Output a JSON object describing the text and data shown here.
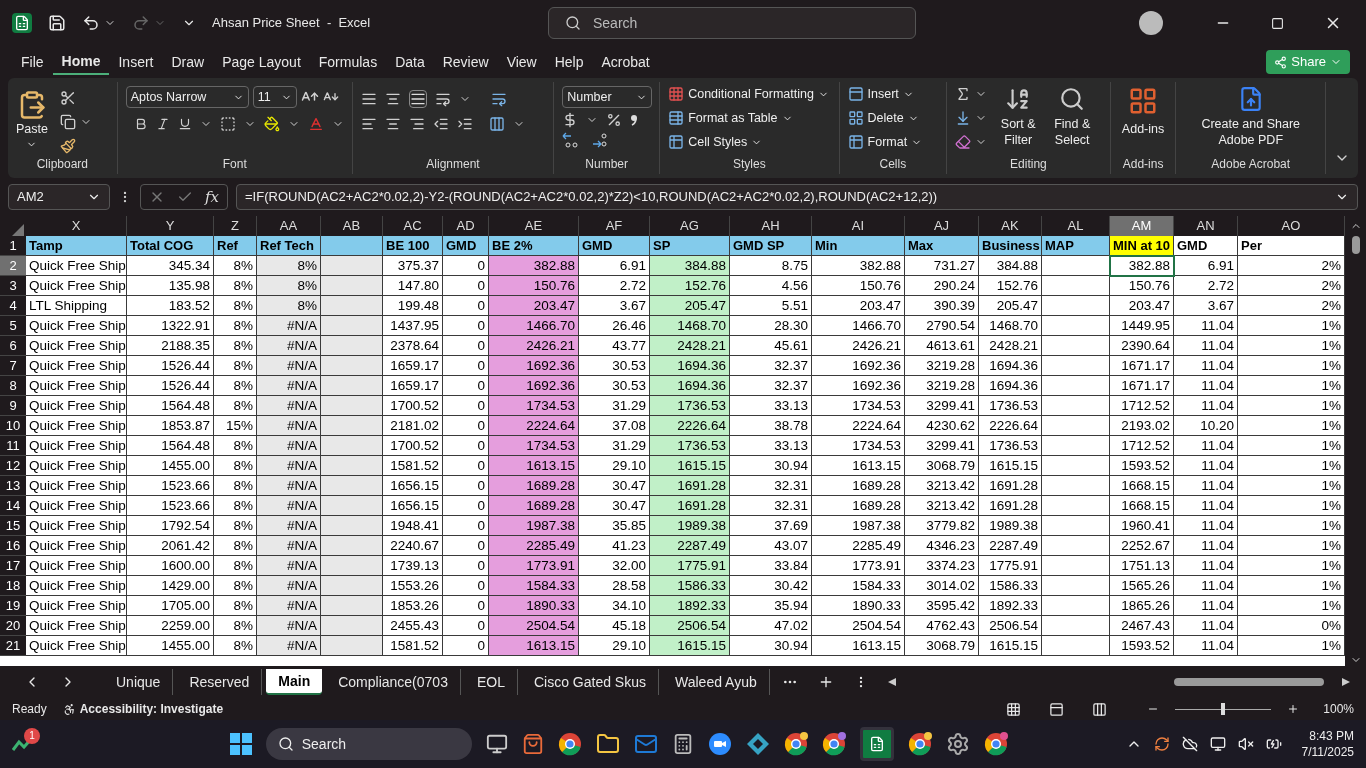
{
  "window": {
    "title": "Ahsan Price Sheet  -  Excel",
    "search_placeholder": "Search"
  },
  "menu_tabs": [
    {
      "label": "File",
      "selected": false
    },
    {
      "label": "Home",
      "selected": true
    },
    {
      "label": "Insert",
      "selected": false
    },
    {
      "label": "Draw",
      "selected": false
    },
    {
      "label": "Page Layout",
      "selected": false
    },
    {
      "label": "Formulas",
      "selected": false
    },
    {
      "label": "Data",
      "selected": false
    },
    {
      "label": "Review",
      "selected": false
    },
    {
      "label": "View",
      "selected": false
    },
    {
      "label": "Help",
      "selected": false
    },
    {
      "label": "Acrobat",
      "selected": false
    }
  ],
  "share_button": "Share",
  "ribbon": {
    "clipboard": {
      "name": "Clipboard",
      "paste": "Paste"
    },
    "font": {
      "name": "Font",
      "font_name": "Aptos Narrow",
      "font_size": "11"
    },
    "alignment": {
      "name": "Alignment"
    },
    "number": {
      "name": "Number",
      "format": "Number"
    },
    "styles": {
      "name": "Styles",
      "buttons": [
        "Conditional Formatting",
        "Format as Table",
        "Cell Styles"
      ]
    },
    "cells": {
      "name": "Cells",
      "buttons": [
        "Insert",
        "Delete",
        "Format"
      ]
    },
    "editing": {
      "name": "Editing",
      "buttons": [
        "Sort & Filter",
        "Find & Select"
      ]
    },
    "addins": {
      "name": "Add-ins",
      "button": "Add-ins"
    },
    "acrobat": {
      "name": "Adobe Acrobat",
      "button": "Create and Share Adobe PDF"
    }
  },
  "formula_bar": {
    "name_box": "AM2",
    "function_label": "fx",
    "formula": "=IF(ROUND(AC2+AC2*0.02,2)-Y2-(ROUND(AC2+AC2*0.02,2)*Z2)<10,ROUND(AC2+AC2*0.02,2),ROUND(AC2+12,2))"
  },
  "columns": [
    {
      "letter": "X",
      "header": "Tamp",
      "kind": "text",
      "color": "#83cbeb",
      "selected": false
    },
    {
      "letter": "Y",
      "header": "Total COG",
      "kind": "number",
      "color": "#83cbeb",
      "selected": false
    },
    {
      "letter": "Z",
      "header": "Ref",
      "kind": "number",
      "color": "#83cbeb",
      "selected": false
    },
    {
      "letter": "AA",
      "header": "Ref Tech",
      "kind": "grey",
      "color": "#83cbeb",
      "selected": false
    },
    {
      "letter": "AB",
      "kind": "grey_blank",
      "color": "#83cbeb",
      "selected": false
    },
    {
      "letter": "AC",
      "header": "BE 100",
      "kind": "number",
      "color": "#83cbeb",
      "selected": false
    },
    {
      "letter": "AD",
      "header": "GMD",
      "kind": "number",
      "color": "#83cbeb",
      "selected": false
    },
    {
      "letter": "AE",
      "header": "BE 2%",
      "kind": "pink",
      "color": "#83cbeb",
      "selected": false
    },
    {
      "letter": "AF",
      "header": "GMD",
      "kind": "number",
      "color": "#83cbeb",
      "selected": false
    },
    {
      "letter": "AG",
      "header": "SP",
      "kind": "green",
      "color": "#83cbeb",
      "selected": false
    },
    {
      "letter": "AH",
      "header": "GMD SP",
      "kind": "number",
      "color": "#83cbeb",
      "selected": false
    },
    {
      "letter": "AI",
      "header": "Min",
      "kind": "number",
      "color": "#83cbeb",
      "selected": false
    },
    {
      "letter": "AJ",
      "header": "Max",
      "kind": "number",
      "color": "#83cbeb",
      "selected": false
    },
    {
      "letter": "AK",
      "header": "Business",
      "kind": "number",
      "color": "#83cbeb",
      "selected": false
    },
    {
      "letter": "AL",
      "header": "MAP",
      "kind": "blank",
      "color": "#83cbeb",
      "selected": false
    },
    {
      "letter": "AM",
      "header": "MIN at 10",
      "kind": "number",
      "color": "#ffff00",
      "selected": true
    },
    {
      "letter": "AN",
      "header": "GMD",
      "kind": "number",
      "color": "#ffffff",
      "selected": false
    },
    {
      "letter": "AO",
      "header": "Per",
      "kind": "number",
      "color": "#ffffff",
      "selected": false
    }
  ],
  "header_row": "1",
  "rows": [
    {
      "n": "2",
      "selected": true,
      "cells": [
        "Quick Free Ship",
        "345.34",
        "8%",
        "8%",
        "375.37",
        "0",
        "382.88",
        "6.91",
        "384.88",
        "8.75",
        "382.88",
        "731.27",
        "384.88",
        "382.88",
        "6.91",
        "2%"
      ]
    },
    {
      "n": "3",
      "selected": false,
      "cells": [
        "Quick Free Ship",
        "135.98",
        "8%",
        "8%",
        "147.80",
        "0",
        "150.76",
        "2.72",
        "152.76",
        "4.56",
        "150.76",
        "290.24",
        "152.76",
        "150.76",
        "2.72",
        "2%"
      ]
    },
    {
      "n": "4",
      "selected": false,
      "cells": [
        "LTL Shipping",
        "183.52",
        "8%",
        "8%",
        "199.48",
        "0",
        "203.47",
        "3.67",
        "205.47",
        "5.51",
        "203.47",
        "390.39",
        "205.47",
        "203.47",
        "3.67",
        "2%"
      ]
    },
    {
      "n": "5",
      "selected": false,
      "cells": [
        "Quick Free Ship",
        "1322.91",
        "8%",
        "#N/A",
        "1437.95",
        "0",
        "1466.70",
        "26.46",
        "1468.70",
        "28.30",
        "1466.70",
        "2790.54",
        "1468.70",
        "1449.95",
        "11.04",
        "1%"
      ]
    },
    {
      "n": "6",
      "selected": false,
      "cells": [
        "Quick Free Ship",
        "2188.35",
        "8%",
        "#N/A",
        "2378.64",
        "0",
        "2426.21",
        "43.77",
        "2428.21",
        "45.61",
        "2426.21",
        "4613.61",
        "2428.21",
        "2390.64",
        "11.04",
        "1%"
      ]
    },
    {
      "n": "7",
      "selected": false,
      "cells": [
        "Quick Free Ship",
        "1526.44",
        "8%",
        "#N/A",
        "1659.17",
        "0",
        "1692.36",
        "30.53",
        "1694.36",
        "32.37",
        "1692.36",
        "3219.28",
        "1694.36",
        "1671.17",
        "11.04",
        "1%"
      ]
    },
    {
      "n": "8",
      "selected": false,
      "cells": [
        "Quick Free Ship",
        "1526.44",
        "8%",
        "#N/A",
        "1659.17",
        "0",
        "1692.36",
        "30.53",
        "1694.36",
        "32.37",
        "1692.36",
        "3219.28",
        "1694.36",
        "1671.17",
        "11.04",
        "1%"
      ]
    },
    {
      "n": "9",
      "selected": false,
      "cells": [
        "Quick Free Ship",
        "1564.48",
        "8%",
        "#N/A",
        "1700.52",
        "0",
        "1734.53",
        "31.29",
        "1736.53",
        "33.13",
        "1734.53",
        "3299.41",
        "1736.53",
        "1712.52",
        "11.04",
        "1%"
      ]
    },
    {
      "n": "10",
      "selected": false,
      "cells": [
        "Quick Free Ship",
        "1853.87",
        "15%",
        "#N/A",
        "2181.02",
        "0",
        "2224.64",
        "37.08",
        "2226.64",
        "38.78",
        "2224.64",
        "4230.62",
        "2226.64",
        "2193.02",
        "10.20",
        "1%"
      ]
    },
    {
      "n": "11",
      "selected": false,
      "cells": [
        "Quick Free Ship",
        "1564.48",
        "8%",
        "#N/A",
        "1700.52",
        "0",
        "1734.53",
        "31.29",
        "1736.53",
        "33.13",
        "1734.53",
        "3299.41",
        "1736.53",
        "1712.52",
        "11.04",
        "1%"
      ]
    },
    {
      "n": "12",
      "selected": false,
      "cells": [
        "Quick Free Ship",
        "1455.00",
        "8%",
        "#N/A",
        "1581.52",
        "0",
        "1613.15",
        "29.10",
        "1615.15",
        "30.94",
        "1613.15",
        "3068.79",
        "1615.15",
        "1593.52",
        "11.04",
        "1%"
      ]
    },
    {
      "n": "13",
      "selected": false,
      "cells": [
        "Quick Free Ship",
        "1523.66",
        "8%",
        "#N/A",
        "1656.15",
        "0",
        "1689.28",
        "30.47",
        "1691.28",
        "32.31",
        "1689.28",
        "3213.42",
        "1691.28",
        "1668.15",
        "11.04",
        "1%"
      ]
    },
    {
      "n": "14",
      "selected": false,
      "cells": [
        "Quick Free Ship",
        "1523.66",
        "8%",
        "#N/A",
        "1656.15",
        "0",
        "1689.28",
        "30.47",
        "1691.28",
        "32.31",
        "1689.28",
        "3213.42",
        "1691.28",
        "1668.15",
        "11.04",
        "1%"
      ]
    },
    {
      "n": "15",
      "selected": false,
      "cells": [
        "Quick Free Ship",
        "1792.54",
        "8%",
        "#N/A",
        "1948.41",
        "0",
        "1987.38",
        "35.85",
        "1989.38",
        "37.69",
        "1987.38",
        "3779.82",
        "1989.38",
        "1960.41",
        "11.04",
        "1%"
      ]
    },
    {
      "n": "16",
      "selected": false,
      "cells": [
        "Quick Free Ship",
        "2061.42",
        "8%",
        "#N/A",
        "2240.67",
        "0",
        "2285.49",
        "41.23",
        "2287.49",
        "43.07",
        "2285.49",
        "4346.23",
        "2287.49",
        "2252.67",
        "11.04",
        "1%"
      ]
    },
    {
      "n": "17",
      "selected": false,
      "cells": [
        "Quick Free Ship",
        "1600.00",
        "8%",
        "#N/A",
        "1739.13",
        "0",
        "1773.91",
        "32.00",
        "1775.91",
        "33.84",
        "1773.91",
        "3374.23",
        "1775.91",
        "1751.13",
        "11.04",
        "1%"
      ]
    },
    {
      "n": "18",
      "selected": false,
      "cells": [
        "Quick Free Ship",
        "1429.00",
        "8%",
        "#N/A",
        "1553.26",
        "0",
        "1584.33",
        "28.58",
        "1586.33",
        "30.42",
        "1584.33",
        "3014.02",
        "1586.33",
        "1565.26",
        "11.04",
        "1%"
      ]
    },
    {
      "n": "19",
      "selected": false,
      "cells": [
        "Quick Free Ship",
        "1705.00",
        "8%",
        "#N/A",
        "1853.26",
        "0",
        "1890.33",
        "34.10",
        "1892.33",
        "35.94",
        "1890.33",
        "3595.42",
        "1892.33",
        "1865.26",
        "11.04",
        "1%"
      ]
    },
    {
      "n": "20",
      "selected": false,
      "cells": [
        "Quick Free Ship",
        "2259.00",
        "8%",
        "#N/A",
        "2455.43",
        "0",
        "2504.54",
        "45.18",
        "2506.54",
        "47.02",
        "2504.54",
        "4762.43",
        "2506.54",
        "2467.43",
        "11.04",
        "0%"
      ]
    },
    {
      "n": "21",
      "selected": false,
      "cells": [
        "Quick Free Ship",
        "1455.00",
        "8%",
        "#N/A",
        "1581.52",
        "0",
        "1613.15",
        "29.10",
        "1615.15",
        "30.94",
        "1613.15",
        "3068.79",
        "1615.15",
        "1593.52",
        "11.04",
        "1%"
      ]
    }
  ],
  "sheet_tabs": [
    {
      "label": "Unique",
      "selected": false
    },
    {
      "label": "Reserved",
      "selected": false
    },
    {
      "label": "Main",
      "selected": true
    },
    {
      "label": "Compliance(0703",
      "selected": false
    },
    {
      "label": "EOL",
      "selected": false
    },
    {
      "label": "Cisco Gated Skus",
      "selected": false
    },
    {
      "label": "Waleed Ayub",
      "selected": false
    }
  ],
  "status_bar": {
    "mode": "Ready",
    "accessibility": "Accessibility: Investigate",
    "zoom": "100%",
    "zoom_slider": {
      "level": 0.5
    }
  },
  "taskbar": {
    "search": "Search",
    "widget_badge": "1",
    "time": "8:43 PM",
    "date": "7/11/2025"
  }
}
